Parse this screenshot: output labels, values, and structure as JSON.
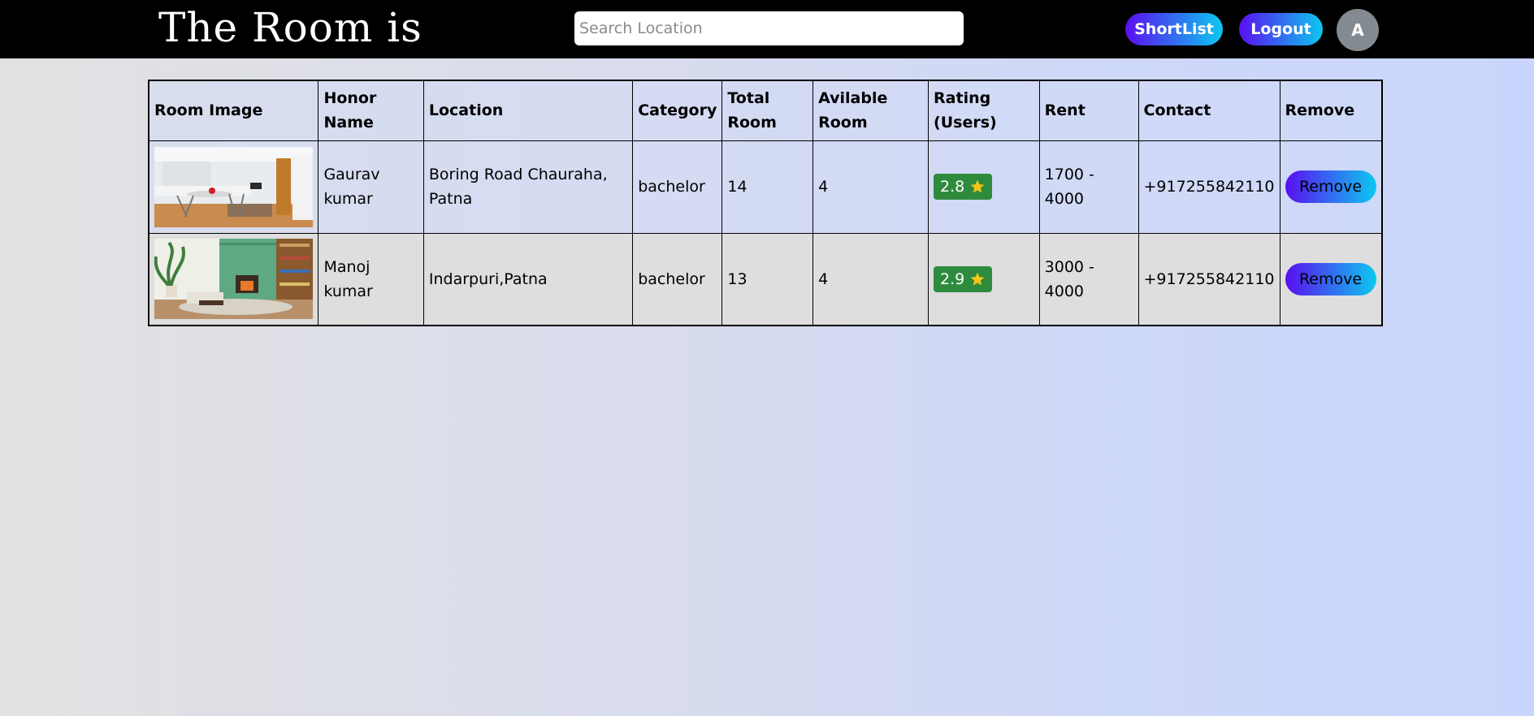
{
  "header": {
    "logo_text": "The Room is",
    "search_placeholder": "Search Location",
    "shortlist_label": "ShortList",
    "logout_label": "Logout",
    "avatar_initial": "A"
  },
  "table": {
    "columns": [
      "Room Image",
      "Honor Name",
      "Location",
      "Category",
      "Total Room",
      "Avilable Room",
      "Rating (Users)",
      "Rent",
      "Contact",
      "Remove"
    ],
    "rows": [
      {
        "honor_name": "Gaurav kumar",
        "location": "Boring Road Chauraha, Patna",
        "category": "bachelor",
        "total_room": "14",
        "available_room": "4",
        "rating": "2.8",
        "rent": "1700 - 4000",
        "contact": "+917255842110",
        "remove_label": "Remove"
      },
      {
        "honor_name": "Manoj kumar",
        "location": "Indarpuri,Patna",
        "category": "bachelor",
        "total_room": "13",
        "available_room": "4",
        "rating": "2.9",
        "rent": "3000 - 4000",
        "contact": "+917255842110",
        "remove_label": "Remove"
      }
    ]
  },
  "colors": {
    "rating_badge": "#2e8b3e",
    "button_gradient_start": "#5a0ff0",
    "button_gradient_end": "#0cc8f0",
    "topbar": "#000000",
    "star": "#f5c518"
  },
  "icons": {
    "rating": "star-icon"
  }
}
